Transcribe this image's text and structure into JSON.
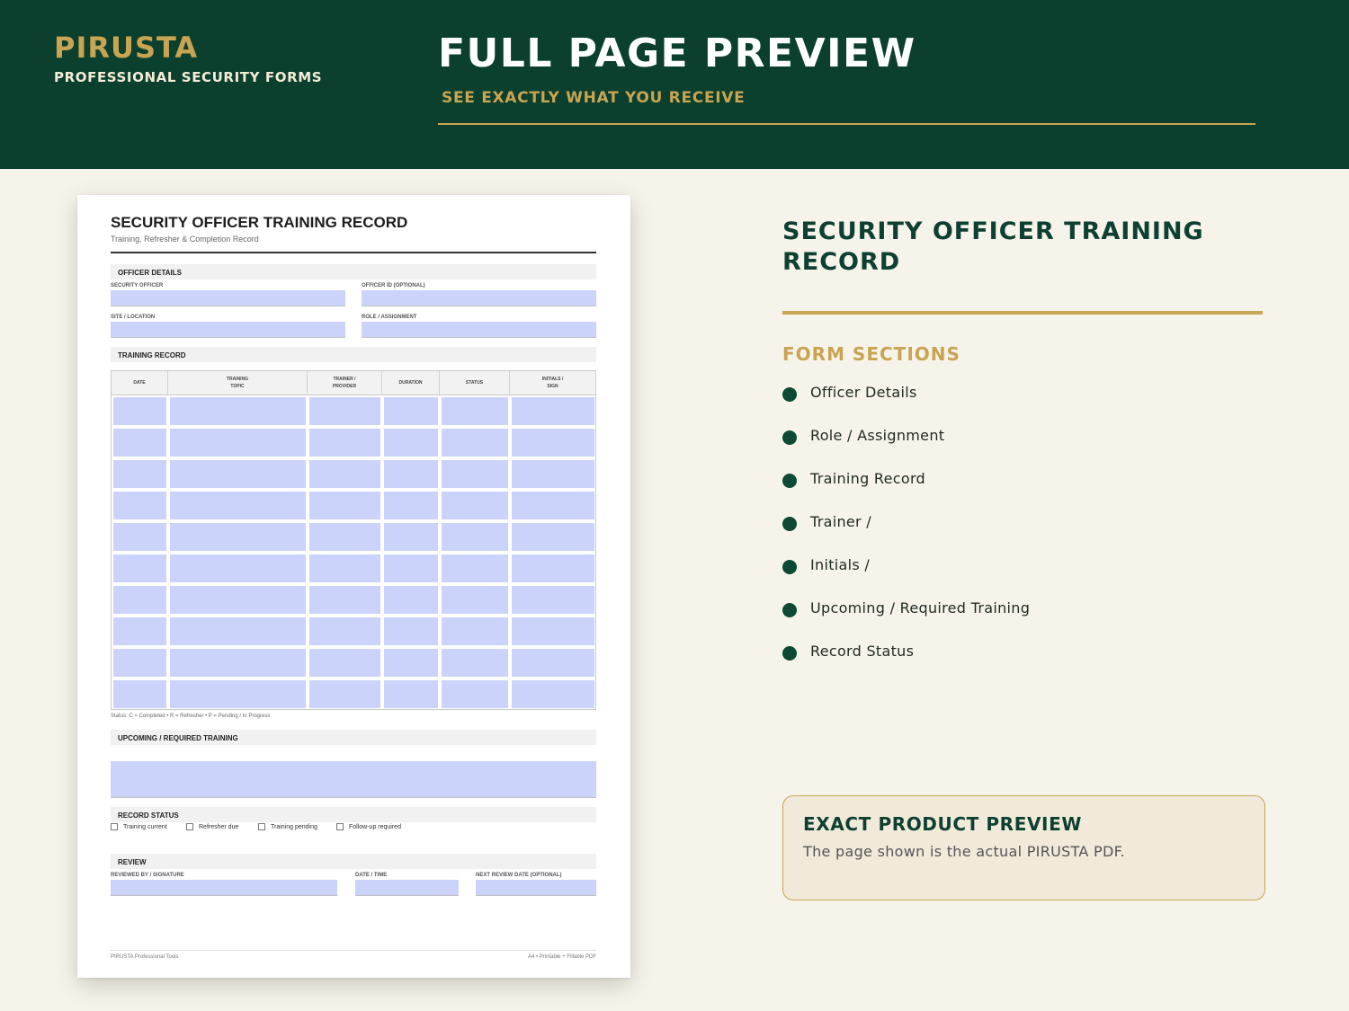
{
  "header": {
    "brand": "PIRUSTA",
    "brand_tagline": "PROFESSIONAL SECURITY FORMS",
    "title": "FULL PAGE PREVIEW",
    "subtitle": "SEE EXACTLY WHAT YOU RECEIVE"
  },
  "document": {
    "title": "SECURITY OFFICER TRAINING RECORD",
    "subtitle": "Training, Refresher & Completion Record",
    "sections": {
      "officer_details": "OFFICER DETAILS",
      "training_record": "TRAINING RECORD",
      "upcoming": "UPCOMING / REQUIRED TRAINING",
      "record_status": "RECORD STATUS",
      "review": "REVIEW"
    },
    "fields": {
      "security_officer": "SECURITY OFFICER",
      "officer_id": "OFFICER ID (OPTIONAL)",
      "site_location": "SITE / LOCATION",
      "role_assignment": "ROLE / ASSIGNMENT",
      "reviewed_by": "REVIEWED BY / SIGNATURE",
      "date_time": "DATE / TIME",
      "next_review": "NEXT REVIEW DATE (OPTIONAL)"
    },
    "table": {
      "headers": [
        "DATE",
        "TRAINING\nTOPIC",
        "TRAINER /\nPROVIDER",
        "DURATION",
        "STATUS",
        "INITIALS /\nSIGN"
      ],
      "row_count": 10
    },
    "status_note": "Status: C = Completed   •   R = Refresher   •   P = Pending / In Progress",
    "checkboxes": [
      "Training current",
      "Refresher due",
      "Training pending",
      "Follow-up required"
    ],
    "footer_left": "PIRUSTA Professional Tools",
    "footer_right": "A4 • Printable + Fillable PDF"
  },
  "panel": {
    "title": "SECURITY OFFICER TRAINING RECORD",
    "sections_heading": "FORM SECTIONS",
    "sections": [
      "Officer Details",
      "Role / Assignment",
      "Training Record",
      "Trainer /",
      "Initials /",
      "Upcoming / Required Training",
      "Record Status"
    ],
    "callout_title": "EXACT PRODUCT PREVIEW",
    "callout_text": "The page shown is the actual PIRUSTA PDF."
  },
  "colors": {
    "header_bg": "#0a402d",
    "accent_gold": "#c9a452",
    "page_bg": "#f6f3ea",
    "field_fill": "#ccd3fb"
  }
}
